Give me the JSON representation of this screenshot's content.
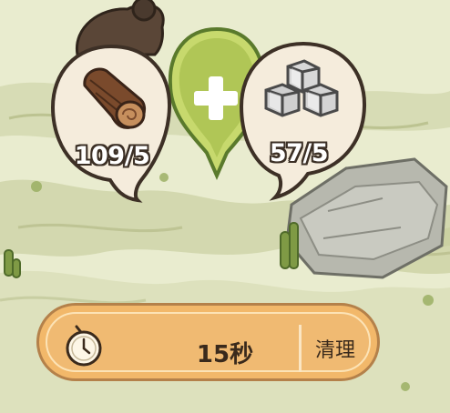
{
  "resources": {
    "wood": {
      "icon": "log-icon",
      "count_text": "109/5"
    },
    "stone": {
      "icon": "stone-blocks-icon",
      "count_text": "57/5"
    }
  },
  "add_button": {
    "icon": "plus-icon"
  },
  "timer": {
    "icon": "stopwatch-icon",
    "time_text": "15秒",
    "action_label": "清理"
  },
  "colors": {
    "background": "#e9eccf",
    "bubble_fill": "#f5ecdc",
    "bubble_border": "#3d3026",
    "add_green": "#b6cc54",
    "timer_fill": "#f2b86a"
  }
}
